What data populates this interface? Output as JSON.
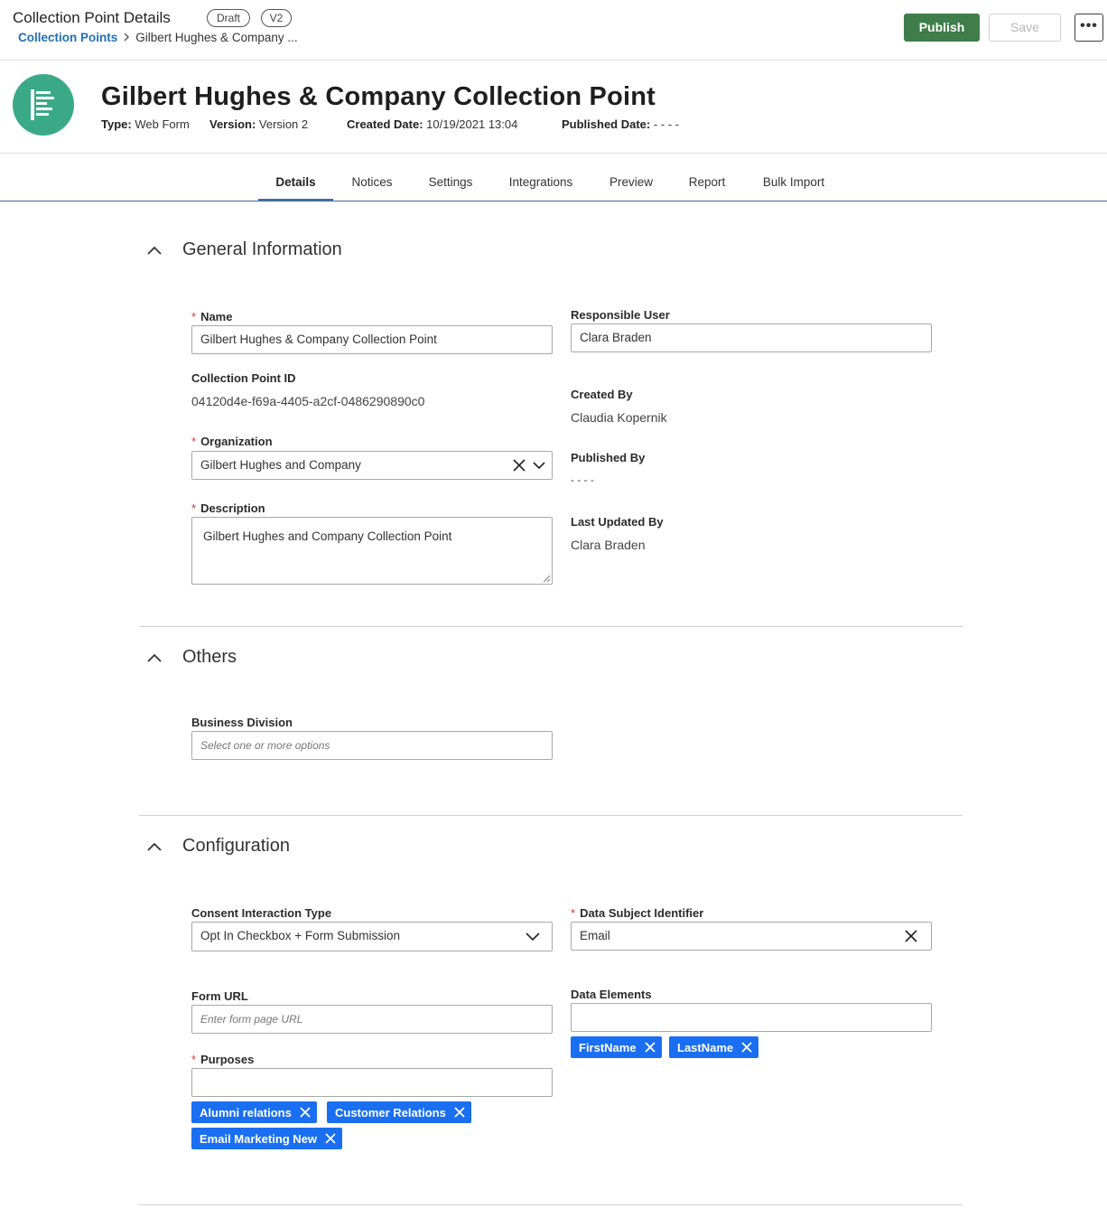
{
  "topbar": {
    "title": "Collection Point Details",
    "status_pill": "Draft",
    "version_pill": "V2",
    "breadcrumb_link": "Collection Points",
    "breadcrumb_current": "Gilbert Hughes & Company ...",
    "publish_label": "Publish",
    "save_label": "Save",
    "more_label": "•••"
  },
  "header": {
    "title": "Gilbert Hughes & Company Collection Point",
    "type_label": "Type:",
    "type_value": "Web Form",
    "version_label": "Version:",
    "version_value": "Version 2",
    "created_label": "Created Date:",
    "created_value": "10/19/2021 13:04",
    "published_label": "Published Date:",
    "published_value": "- - - -",
    "logo_icon": "collection-point-icon",
    "logo_color": "#3aaa86"
  },
  "tabs": [
    "Details",
    "Notices",
    "Settings",
    "Integrations",
    "Preview",
    "Report",
    "Bulk Import"
  ],
  "active_tab": "Details",
  "general": {
    "title": "General Information",
    "name_label": "Name",
    "name_value": "Gilbert Hughes & Company Collection Point",
    "cpid_label": "Collection Point ID",
    "cpid_value": "04120d4e-f69a-4405-a2cf-0486290890c0",
    "org_label": "Organization",
    "org_value": "Gilbert Hughes and Company",
    "desc_label": "Description",
    "desc_value": "Gilbert Hughes and Company Collection Point",
    "responsible_label": "Responsible User",
    "responsible_value": "Clara Braden",
    "created_by_label": "Created By",
    "created_by_value": "Claudia Kopernik",
    "published_by_label": "Published By",
    "published_by_value": "- - - -",
    "updated_by_label": "Last Updated By",
    "updated_by_value": "Clara Braden"
  },
  "others": {
    "title": "Others",
    "division_label": "Business Division",
    "division_placeholder": "Select one or more options"
  },
  "configuration": {
    "title": "Configuration",
    "consent_label": "Consent Interaction Type",
    "consent_value": "Opt In Checkbox + Form Submission",
    "identifier_label": "Data Subject Identifier",
    "identifier_value": "Email",
    "form_url_label": "Form URL",
    "form_url_placeholder": "Enter form page URL",
    "data_elements_label": "Data Elements",
    "data_elements": [
      "FirstName",
      "LastName"
    ],
    "purposes_label": "Purposes",
    "purposes": [
      "Alumni relations",
      "Customer Relations",
      "Email Marketing New"
    ]
  },
  "colors": {
    "accent": "#3f6e9a",
    "publish": "#3f7d4a",
    "tag": "#1a6ef2",
    "required": "#d23a3a"
  }
}
